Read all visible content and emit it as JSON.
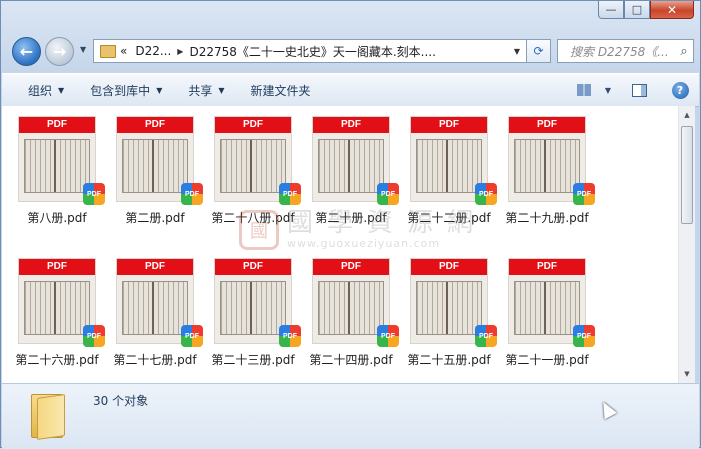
{
  "window": {
    "minimize": "—",
    "maximize": "□",
    "close": "✕"
  },
  "nav": {
    "back_glyph": "←",
    "forward_glyph": "→",
    "address": {
      "prefix": "«",
      "crumb1": "D22...",
      "crumb2": "D22758《二十一史北史》天一阁藏本.刻本...."
    },
    "search_placeholder": "搜索 D22758《..."
  },
  "toolbar": {
    "organize": "组织",
    "include_in_library": "包含到库中",
    "share": "共享",
    "new_folder": "新建文件夹"
  },
  "files": [
    {
      "name": "第八册.pdf"
    },
    {
      "name": "第二册.pdf"
    },
    {
      "name": "第二十八册.pdf"
    },
    {
      "name": "第二十册.pdf"
    },
    {
      "name": "第二十二册.pdf"
    },
    {
      "name": "第二十九册.pdf"
    },
    {
      "name": "第二十六册.pdf"
    },
    {
      "name": "第二十七册.pdf"
    },
    {
      "name": "第二十三册.pdf"
    },
    {
      "name": "第二十四册.pdf"
    },
    {
      "name": "第二十五册.pdf"
    },
    {
      "name": "第二十一册.pdf"
    }
  ],
  "thumb_band_label": "PDF",
  "badge_label": "PDF",
  "watermark": {
    "seal": "國",
    "title": "國學資源網",
    "url": "www.guoxueziyuan.com"
  },
  "status": {
    "count_text": "30 个对象"
  },
  "colors": {
    "pdf_band": "#e20f17",
    "toolbar_text": "#1e3b5c"
  }
}
